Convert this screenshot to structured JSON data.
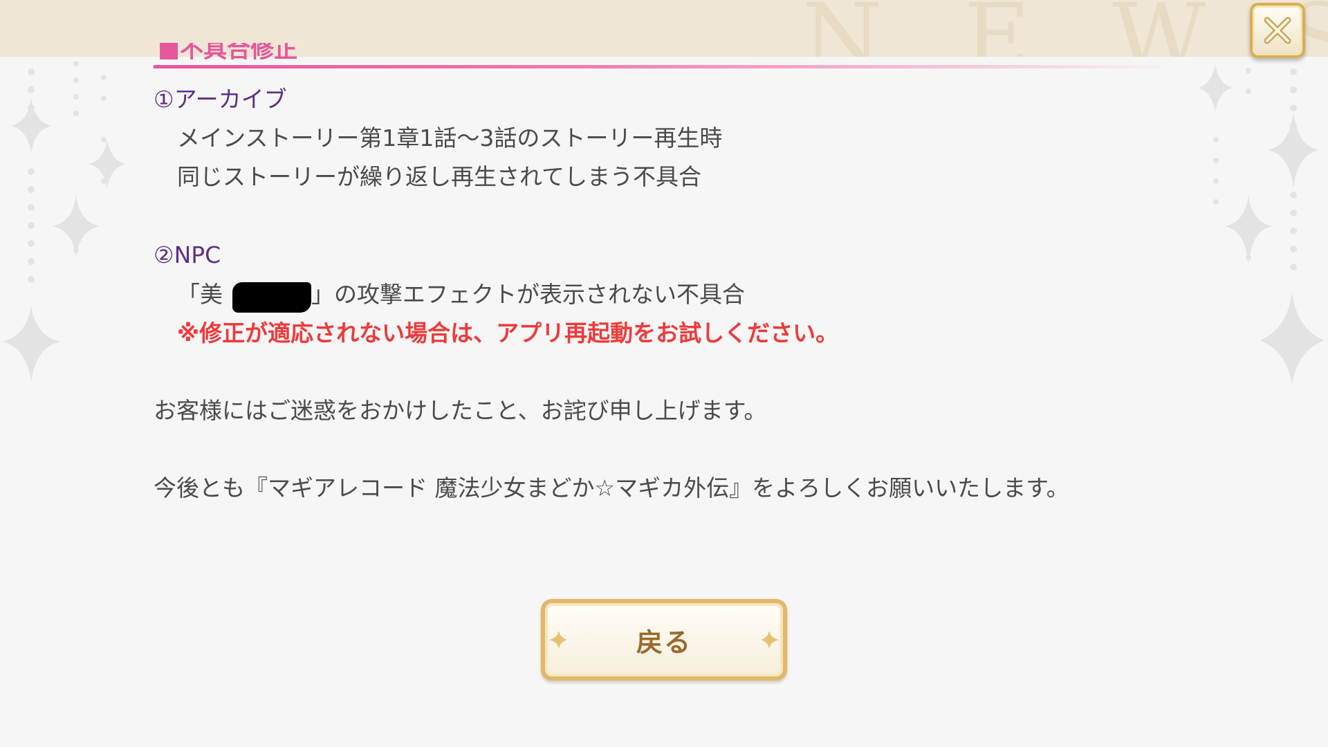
{
  "header": {
    "watermark": "N E W S",
    "close_icon": "close-icon"
  },
  "title_fragment": "■不具合修正",
  "sections": [
    {
      "heading": "①アーカイブ",
      "lines": [
        "メインストーリー第1章1話～3話のストーリー再生時",
        "同じストーリーが繰り返し再生されてしまう不具合"
      ]
    },
    {
      "heading": "②NPC",
      "line_prefix": "「美",
      "line_suffix": "」の攻撃エフェクトが表示されない不具合",
      "warning": "※修正が適応されない場合は、アプリ再起動をお試しください。"
    }
  ],
  "apology": "お客様にはご迷惑をおかけしたこと、お詫び申し上げます。",
  "closing": "今後とも『マギアレコード 魔法少女まどか☆マギカ外伝』をよろしくお願いいたします。",
  "back_button": {
    "label": "戻る"
  },
  "colors": {
    "accent_pink": "#e8559a",
    "heading_purple": "#5e2e84",
    "warning_red": "#ee3a3a",
    "gold": "#d9ae56"
  }
}
